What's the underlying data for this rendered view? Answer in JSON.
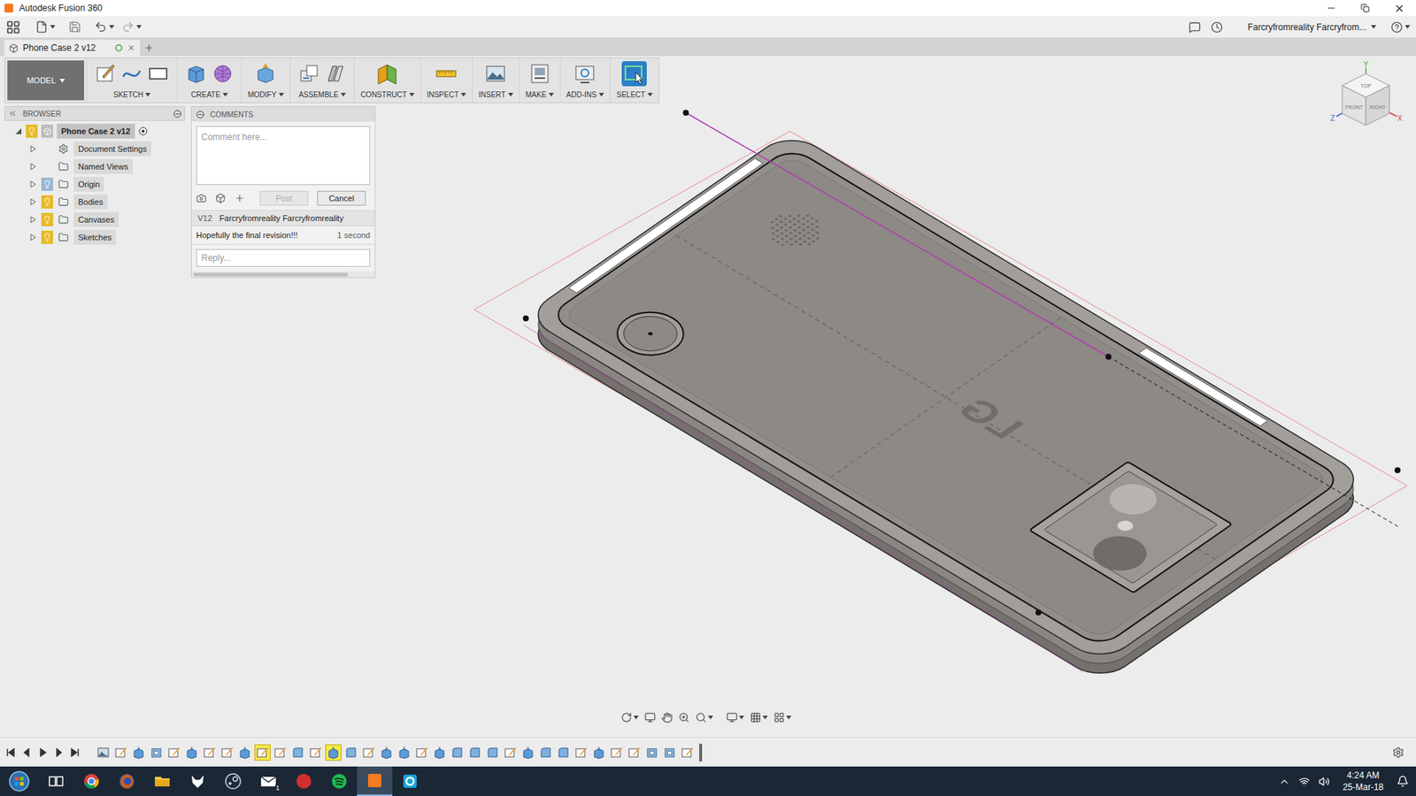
{
  "window": {
    "title": "Autodesk Fusion 360"
  },
  "quick_access": {
    "user": "Farcryfromreality Farcryfrom..."
  },
  "document_tab": {
    "label": "Phone Case 2 v12",
    "selected": true
  },
  "toolbar": {
    "workspace": "MODEL",
    "groups": [
      {
        "label": "SKETCH",
        "icons": [
          "sketch",
          "line",
          "rectangle"
        ],
        "selected": false
      },
      {
        "label": "CREATE",
        "icons": [
          "box",
          "form"
        ],
        "selected": false
      },
      {
        "label": "MODIFY",
        "icons": [
          "modify"
        ],
        "selected": false
      },
      {
        "label": "ASSEMBLE",
        "icons": [
          "component",
          "joint"
        ],
        "selected": false
      },
      {
        "label": "CONSTRUCT",
        "icons": [
          "plane"
        ],
        "selected": false
      },
      {
        "label": "INSPECT",
        "icons": [
          "measure"
        ],
        "selected": false
      },
      {
        "label": "INSERT",
        "icons": [
          "image"
        ],
        "selected": false
      },
      {
        "label": "MAKE",
        "icons": [
          "print"
        ],
        "selected": false
      },
      {
        "label": "ADD-INS",
        "icons": [
          "addins"
        ],
        "selected": false
      },
      {
        "label": "SELECT",
        "icons": [
          "select"
        ],
        "selected": true
      }
    ]
  },
  "browser": {
    "title": "BROWSER",
    "root": {
      "label": "Phone Case 2 v12",
      "visible": true,
      "expanded": true
    },
    "items": [
      {
        "label": "Document Settings",
        "kind": "settings",
        "has_light": false,
        "visible": false,
        "expanded": false
      },
      {
        "label": "Named Views",
        "kind": "folder",
        "has_light": false,
        "visible": false,
        "expanded": false
      },
      {
        "label": "Origin",
        "kind": "folder",
        "has_light": true,
        "visible": false,
        "expanded": false
      },
      {
        "label": "Bodies",
        "kind": "folder",
        "has_light": true,
        "visible": true,
        "expanded": false
      },
      {
        "label": "Canvases",
        "kind": "folder",
        "has_light": true,
        "visible": true,
        "expanded": false
      },
      {
        "label": "Sketches",
        "kind": "folder",
        "has_light": true,
        "visible": true,
        "expanded": false
      }
    ]
  },
  "comments": {
    "title": "COMMENTS",
    "placeholder": "Comment here...",
    "post": {
      "label": "Post",
      "disabled": true
    },
    "cancel": {
      "label": "Cancel",
      "disabled": false
    },
    "thread": {
      "version": "V12",
      "author": "Farcryfromreality Farcryfromreality",
      "text": "Hopefully the final revision!!!",
      "time": "1 second",
      "reply_placeholder": "Reply..."
    }
  },
  "model": {
    "logo": "LG"
  },
  "viewcube": {
    "faces": [
      "TOP",
      "FRONT",
      "RIGHT"
    ],
    "axes": [
      "X",
      "Y",
      "Z"
    ]
  },
  "timeline": {
    "features": [
      {
        "kind": "canvas",
        "highlighted": false
      },
      {
        "kind": "sketch",
        "highlighted": false
      },
      {
        "kind": "extrude",
        "highlighted": false
      },
      {
        "kind": "shell",
        "highlighted": false
      },
      {
        "kind": "sketch",
        "highlighted": false
      },
      {
        "kind": "extrude",
        "highlighted": false
      },
      {
        "kind": "sketch",
        "highlighted": false
      },
      {
        "kind": "sketch",
        "highlighted": false
      },
      {
        "kind": "extrude",
        "highlighted": false
      },
      {
        "kind": "sketch",
        "highlighted": true
      },
      {
        "kind": "sketch",
        "highlighted": false
      },
      {
        "kind": "fillet",
        "highlighted": false
      },
      {
        "kind": "sketch",
        "highlighted": false
      },
      {
        "kind": "extrude",
        "highlighted": true
      },
      {
        "kind": "fillet",
        "highlighted": false
      },
      {
        "kind": "sketch",
        "highlighted": false
      },
      {
        "kind": "extrude",
        "highlighted": false
      },
      {
        "kind": "extrude",
        "highlighted": false
      },
      {
        "kind": "sketch",
        "highlighted": false
      },
      {
        "kind": "extrude",
        "highlighted": false
      },
      {
        "kind": "fillet",
        "highlighted": false
      },
      {
        "kind": "fillet",
        "highlighted": false
      },
      {
        "kind": "fillet",
        "highlighted": false
      },
      {
        "kind": "sketch",
        "highlighted": false
      },
      {
        "kind": "extrude",
        "highlighted": false
      },
      {
        "kind": "fillet",
        "highlighted": false
      },
      {
        "kind": "fillet",
        "highlighted": false
      },
      {
        "kind": "sketch",
        "highlighted": false
      },
      {
        "kind": "extrude",
        "highlighted": false
      },
      {
        "kind": "sketch",
        "highlighted": false
      },
      {
        "kind": "sketch",
        "highlighted": false
      },
      {
        "kind": "shell",
        "highlighted": false
      },
      {
        "kind": "shell",
        "highlighted": false
      },
      {
        "kind": "sketch",
        "highlighted": false
      }
    ]
  },
  "taskbar": {
    "apps": [
      {
        "kind": "taskview",
        "active": false,
        "badge": ""
      },
      {
        "kind": "chrome",
        "active": false,
        "badge": ""
      },
      {
        "kind": "firefox",
        "active": false,
        "badge": ""
      },
      {
        "kind": "explorer",
        "active": false,
        "badge": ""
      },
      {
        "kind": "fox",
        "active": false,
        "badge": ""
      },
      {
        "kind": "steam",
        "active": false,
        "badge": ""
      },
      {
        "kind": "mail",
        "active": false,
        "badge": "1"
      },
      {
        "kind": "red",
        "active": false,
        "badge": ""
      },
      {
        "kind": "spotify",
        "active": false,
        "badge": ""
      },
      {
        "kind": "fusion",
        "active": true,
        "badge": ""
      },
      {
        "kind": "cyan",
        "active": false,
        "badge": ""
      }
    ],
    "time": "4:24 AM",
    "date": "25-Mar-18"
  }
}
